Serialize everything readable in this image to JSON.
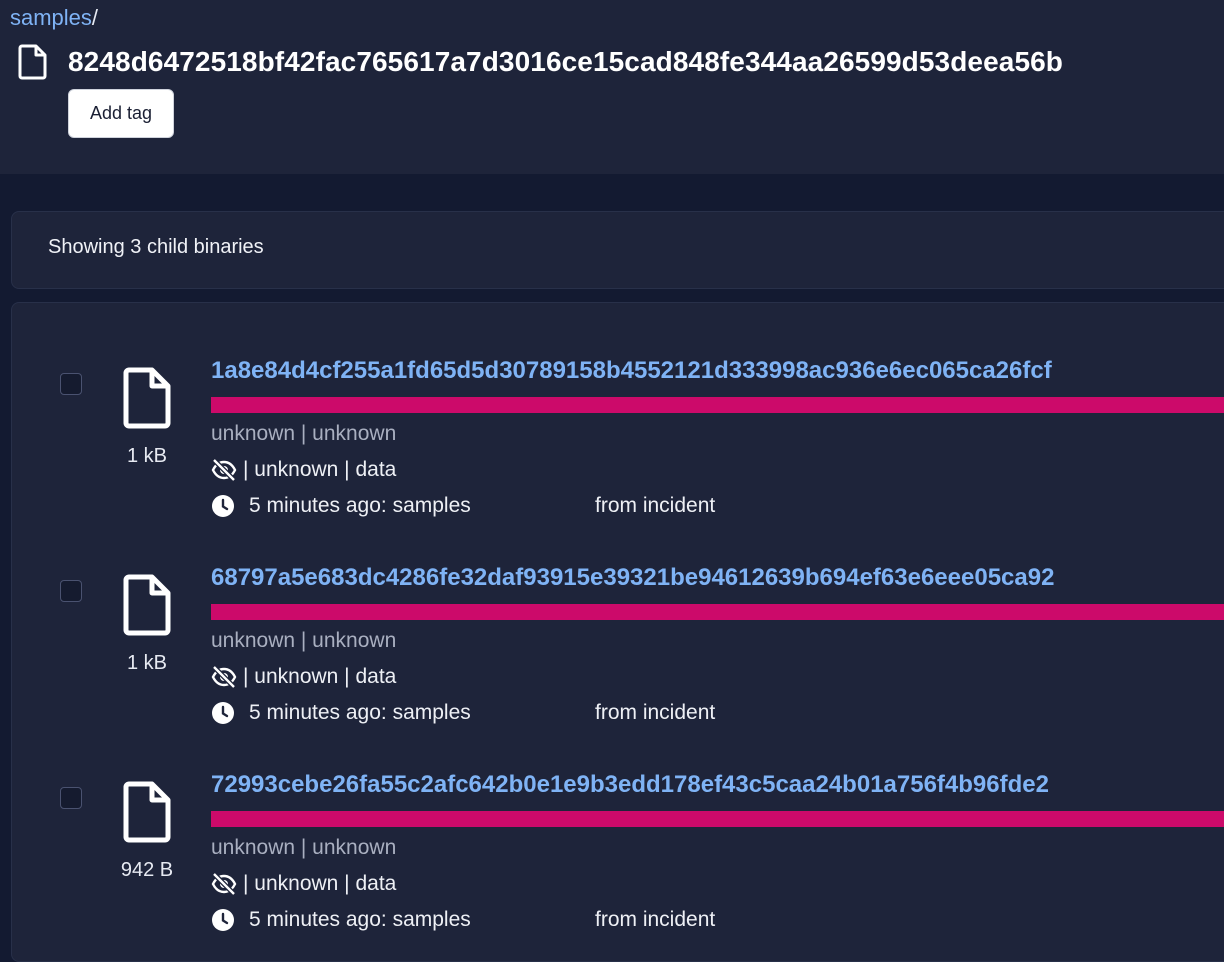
{
  "breadcrumb": {
    "link": "samples",
    "separator": "/"
  },
  "header": {
    "title": "8248d6472518bf42fac765617a7d3016ce15cad848fe344aa26599d53deea56b",
    "add_tag_label": "Add tag"
  },
  "summary": {
    "text": "Showing 3 child binaries"
  },
  "colors": {
    "accent_bar": "#cc0a6a",
    "link": "#7fb3f5",
    "background": "#1e243a"
  },
  "items": [
    {
      "hash": "1a8e84d4cf255a1fd65d5d30789158b4552121d333998ac936e6ec065ca26fcf",
      "size": "1 kB",
      "type_line": "unknown | unknown",
      "detail_line": "| unknown | data",
      "time_line": "5 minutes ago: samples",
      "source": "from incident"
    },
    {
      "hash": "68797a5e683dc4286fe32daf93915e39321be94612639b694ef63e6eee05ca92",
      "size": "1 kB",
      "type_line": "unknown | unknown",
      "detail_line": "| unknown | data",
      "time_line": "5 minutes ago: samples",
      "source": "from incident"
    },
    {
      "hash": "72993cebe26fa55c2afc642b0e1e9b3edd178ef43c5caa24b01a756f4b96fde2",
      "size": "942 B",
      "type_line": "unknown | unknown",
      "detail_line": "| unknown | data",
      "time_line": "5 minutes ago: samples",
      "source": "from incident"
    }
  ]
}
